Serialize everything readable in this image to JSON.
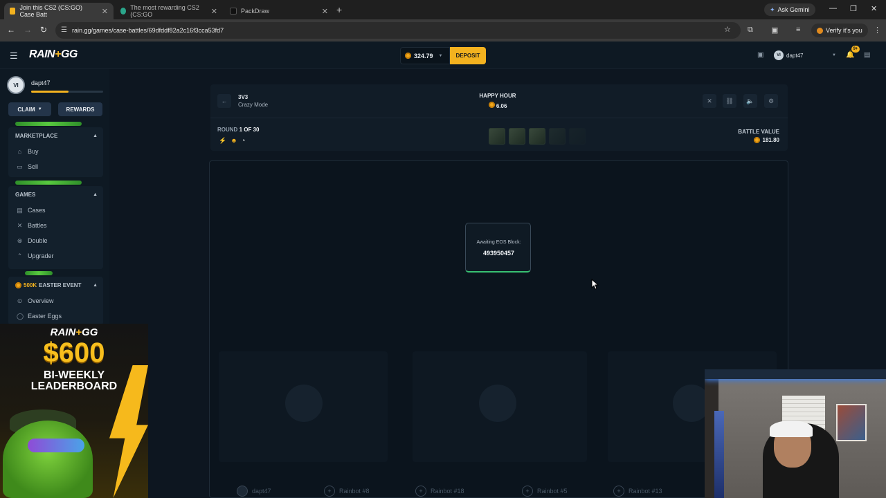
{
  "browser": {
    "tabs": [
      {
        "title": "Join this CS2 (CS:GO) Case Batt",
        "favicon_color": "#f3b21f",
        "active": true
      },
      {
        "title": "The most rewarding CS2 (CS:GO",
        "favicon_color": "#2aa58a",
        "active": false
      },
      {
        "title": "PackDraw",
        "favicon_color": "#111111",
        "active": false
      }
    ],
    "gemini_label": "Ask Gemini",
    "url": "rain.gg/games/case-battles/69dfddf82a2c16f3cca53fd7",
    "verify_label": "Verify it's you"
  },
  "header": {
    "logo": "RAIN",
    "logo_plus": "+",
    "logo_suffix": "GG",
    "balance": "324.79",
    "deposit_label": "DEPOSIT",
    "username": "dapt47",
    "avatar_initials": "VI",
    "notification_badge": "9+"
  },
  "sidebar": {
    "username": "dapt47",
    "avatar_initials": "VI",
    "xp_fraction": 0.52,
    "claim_label": "CLAIM",
    "rewards_label": "REWARDS",
    "marketplace": {
      "title": "MARKETPLACE",
      "items": [
        {
          "label": "Buy",
          "icon": "bag-icon"
        },
        {
          "label": "Sell",
          "icon": "sell-icon"
        }
      ]
    },
    "games": {
      "title": "GAMES",
      "items": [
        {
          "label": "Cases",
          "icon": "cases-icon"
        },
        {
          "label": "Battles",
          "icon": "swords-icon"
        },
        {
          "label": "Double",
          "icon": "double-icon"
        },
        {
          "label": "Upgrader",
          "icon": "upgrade-icon"
        }
      ]
    },
    "event": {
      "prefix": "500K",
      "title": "EASTER EVENT",
      "items": [
        {
          "label": "Overview",
          "icon": "overview-icon"
        },
        {
          "label": "Easter Eggs",
          "icon": "egg-icon"
        }
      ]
    }
  },
  "battle": {
    "mode_title": "3V3",
    "mode_sub": "Crazy Mode",
    "happy_hour_label": "HAPPY HOUR",
    "happy_hour_value": "6.06",
    "round_prefix": "ROUND",
    "round_current": "1 OF 30",
    "battle_value_label": "BATTLE VALUE",
    "battle_value": "181.80",
    "eos_label": "Awaiting EOS Block:",
    "eos_block": "493950457",
    "players": [
      {
        "name": "dapt47"
      },
      {
        "name": "Rainbot #8"
      },
      {
        "name": "Rainbot #18"
      },
      {
        "name": "Rainbot #5"
      },
      {
        "name": "Rainbot #13"
      }
    ]
  },
  "promo": {
    "logo": "RAIN",
    "logo_plus": "+",
    "logo_suffix": "GG",
    "amount": "$600",
    "line1": "BI-WEEKLY",
    "line2": "LEADERBOARD",
    "accent": "#f6b91c"
  }
}
